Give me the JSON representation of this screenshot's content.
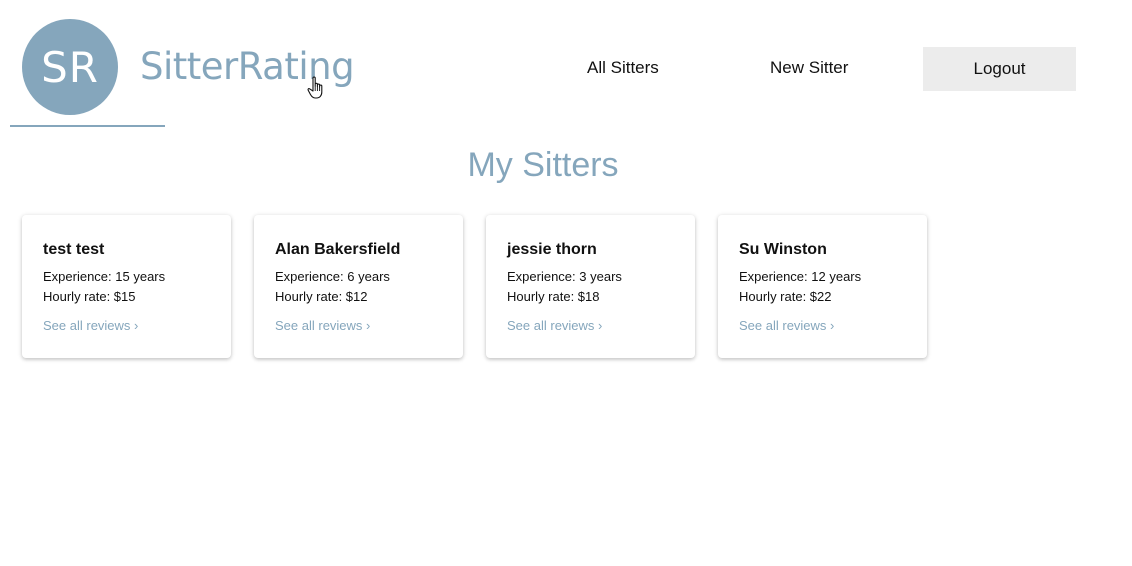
{
  "brand": {
    "initials": "SR",
    "name": "SitterRating",
    "color": "#85a6bc"
  },
  "nav": {
    "all_sitters": "All Sitters",
    "new_sitter": "New Sitter",
    "logout": "Logout"
  },
  "page_title": "My Sitters",
  "sitters": [
    {
      "name": "test test",
      "experience": "Experience: 15 years",
      "rate": "Hourly rate: $15",
      "reviews_link": "See all reviews ›"
    },
    {
      "name": "Alan Bakersfield",
      "experience": "Experience: 6 years",
      "rate": "Hourly rate: $12",
      "reviews_link": "See all reviews ›"
    },
    {
      "name": "jessie thorn",
      "experience": "Experience: 3 years",
      "rate": "Hourly rate: $18",
      "reviews_link": "See all reviews ›"
    },
    {
      "name": "Su Winston",
      "experience": "Experience: 12 years",
      "rate": "Hourly rate: $22",
      "reviews_link": "See all reviews ›"
    }
  ],
  "icons": {
    "cursor": "hand-pointer-cursor-icon"
  }
}
